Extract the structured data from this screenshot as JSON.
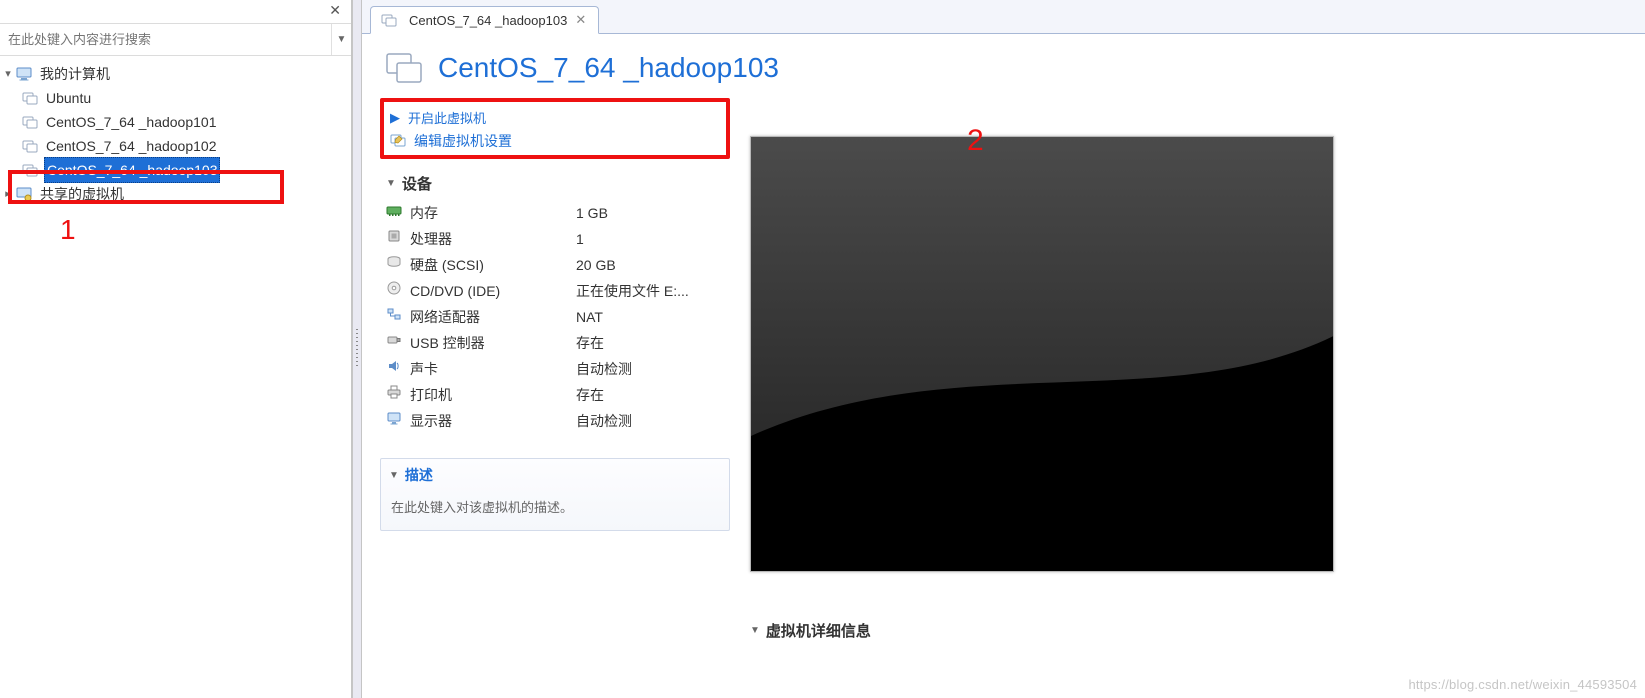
{
  "sidebar": {
    "search_placeholder": "在此处键入内容进行搜索",
    "root_label": "我的计算机",
    "items": [
      {
        "label": "Ubuntu"
      },
      {
        "label": "CentOS_7_64 _hadoop101"
      },
      {
        "label": "CentOS_7_64 _hadoop102"
      },
      {
        "label": "CentOS_7_64 _hadoop103",
        "selected": true
      }
    ],
    "shared_label": "共享的虚拟机"
  },
  "annotations": {
    "num1": "1",
    "num2": "2"
  },
  "tab": {
    "label": "CentOS_7_64 _hadoop103"
  },
  "page": {
    "title": "CentOS_7_64 _hadoop103"
  },
  "actions": {
    "start": "开启此虚拟机",
    "edit": "编辑虚拟机设置"
  },
  "sections": {
    "devices": "设备",
    "description": "描述",
    "details": "虚拟机详细信息"
  },
  "devices": [
    {
      "icon": "memory",
      "name": "内存",
      "value": "1 GB"
    },
    {
      "icon": "cpu",
      "name": "处理器",
      "value": "1"
    },
    {
      "icon": "disk",
      "name": "硬盘 (SCSI)",
      "value": "20 GB"
    },
    {
      "icon": "cd",
      "name": "CD/DVD (IDE)",
      "value": "正在使用文件 E:..."
    },
    {
      "icon": "net",
      "name": "网络适配器",
      "value": "NAT"
    },
    {
      "icon": "usb",
      "name": "USB 控制器",
      "value": "存在"
    },
    {
      "icon": "sound",
      "name": "声卡",
      "value": "自动检测"
    },
    {
      "icon": "printer",
      "name": "打印机",
      "value": "存在"
    },
    {
      "icon": "display",
      "name": "显示器",
      "value": "自动检测"
    }
  ],
  "description_placeholder": "在此处键入对该虚拟机的描述。",
  "watermark": "https://blog.csdn.net/weixin_44593504"
}
